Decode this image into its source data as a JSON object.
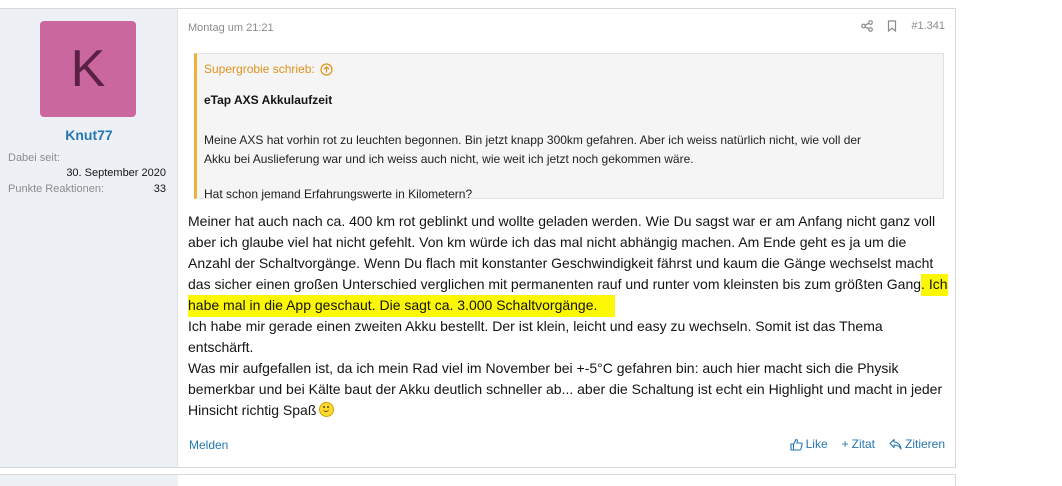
{
  "user": {
    "avatar_letter": "K",
    "avatar_color": "#c9679e",
    "name": "Knut77",
    "joined_label": "Dabei seit:",
    "joined_value": "30. September 2020",
    "reactions_label": "Punkte Reaktionen:",
    "reactions_value": "33"
  },
  "post": {
    "date": "Montag um 21:21",
    "number": "#1.341",
    "share_icon": "share-icon",
    "bookmark_icon": "bookmark-icon",
    "quote": {
      "author": "Supergrobie schrieb:",
      "title": "eTap AXS Akkulaufzeit",
      "para1_line1": "Meine AXS hat vorhin rot zu leuchten begonnen. Bin jetzt knapp 300km gefahren. Aber ich weiss natürlich nicht, wie voll der",
      "para1_line2": "Akku bei Auslieferung war und ich weiss auch nicht, wie weit ich jetzt noch gekommen wäre.",
      "para2": "Hat schon jemand Erfahrungswerte in Kilometern?"
    },
    "body": {
      "p1": "Meiner hat auch nach ca. 400 km rot geblinkt und wollte geladen werden. Wie Du sagst war er am Anfang nicht ganz voll aber ich glaube viel hat nicht gefehlt. Von km würde ich das mal nicht abhängig machen. Am Ende geht es ja um die Anzahl der Schaltvorgänge. Wenn Du flach mit konstanter Geschwindigkeit fährst und kaum die Gänge wechselst macht das sicher einen großen Unterschied verglichen mit permanenten rauf und runter vom kleinsten bis zum größten Gang",
      "highlight": ". Ich habe mal in die App geschaut. Die sagt ca. 3.000 Schaltvorgänge.",
      "p2": "Ich habe mir gerade einen zweiten Akku bestellt. Der ist klein, leicht und easy zu wechseln. Somit ist das Thema entschärft.",
      "p3": "Was mir aufgefallen ist, da ich mein Rad viel im November bei +-5°C gefahren bin: auch hier macht sich die Physik bemerkbar und bei Kälte baut der Akku deutlich schneller ab... aber die Schaltung ist echt ein Highlight und macht in jeder Hinsicht richtig Spaß"
    },
    "highlight_color": "#fbf705",
    "actions": {
      "report": "Melden",
      "like": "Like",
      "quote": "Zitat",
      "reply": "Zitieren"
    }
  },
  "colors": {
    "link": "#2577b1",
    "quote_accent": "#f0b13a",
    "userpane_bg": "#edf1f6"
  }
}
